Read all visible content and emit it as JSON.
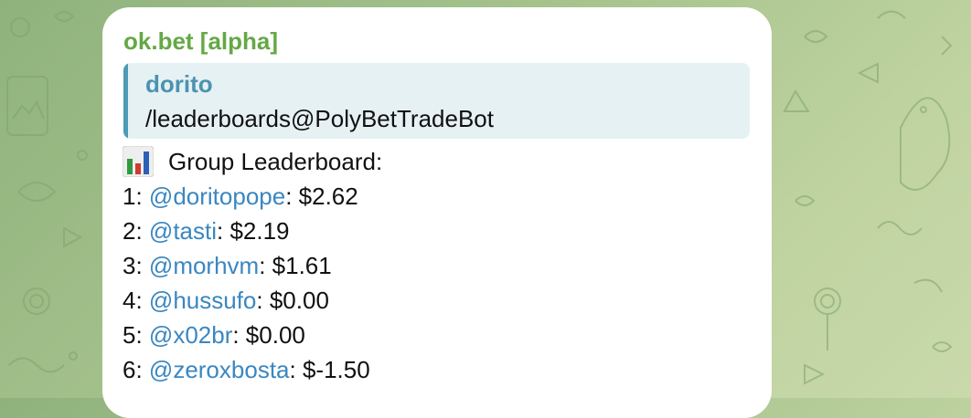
{
  "message": {
    "sender": "ok.bet [alpha]",
    "reply": {
      "author": "dorito",
      "text": "/leaderboards@PolyBetTradeBot"
    },
    "leaderboard": {
      "icon": "bar-chart-icon",
      "title": "Group Leaderboard:",
      "entries": [
        {
          "rank": "1:",
          "user": "@doritopope",
          "amount": ": $2.62"
        },
        {
          "rank": "2:",
          "user": "@tasti",
          "amount": ": $2.19"
        },
        {
          "rank": "3:",
          "user": "@morhvm",
          "amount": ": $1.61"
        },
        {
          "rank": "4:",
          "user": "@hussufo",
          "amount": ": $0.00"
        },
        {
          "rank": "5:",
          "user": "@x02br",
          "amount": ": $0.00"
        },
        {
          "rank": "6:",
          "user": "@zeroxbosta",
          "amount": ": $-1.50"
        }
      ]
    }
  },
  "colors": {
    "sender": "#65a845",
    "mention": "#3a87c1",
    "reply_accent": "#4d9bb5",
    "reply_bg": "#e6f1f4",
    "bubble": "#ffffff"
  }
}
